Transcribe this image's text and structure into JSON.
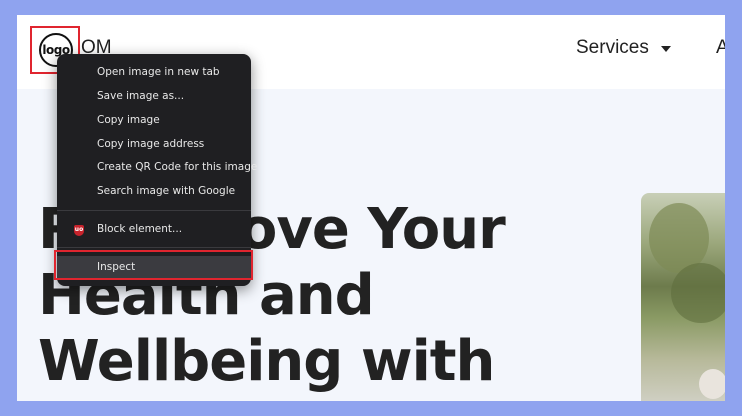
{
  "header": {
    "logo_text": "logo",
    "brand_suffix": "OM",
    "nav_services": "Services",
    "nav_next": "A"
  },
  "hero": {
    "line1": "Rediscove Your",
    "line2": "Health and",
    "line3": "Wellbeing with"
  },
  "context_menu": {
    "items": [
      "Open image in new tab",
      "Save image as...",
      "Copy image",
      "Copy image address",
      "Create QR Code for this image",
      "Search image with Google"
    ],
    "block_element": "Block element...",
    "block_icon_text": "uo",
    "inspect": "Inspect"
  },
  "colors": {
    "outer_background": "#8fa3ef",
    "highlight_outline": "#e0252f",
    "menu_background": "#1f1f22"
  }
}
